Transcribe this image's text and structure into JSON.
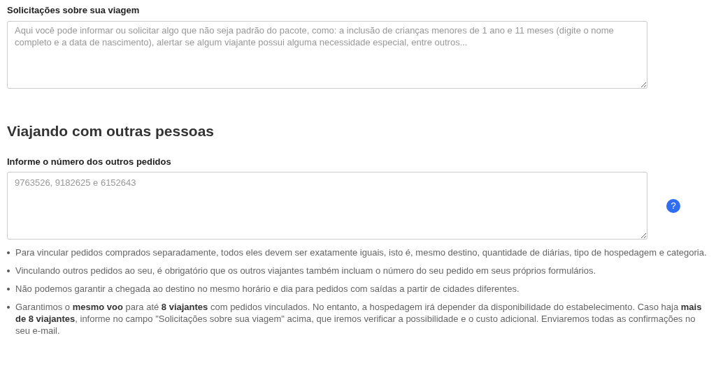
{
  "requests": {
    "label": "Solicitações sobre sua viagem",
    "placeholder": "Aqui você pode informar ou solicitar algo que não seja padrão do pacote, como: a inclusão de crianças menores de 1 ano e 11 meses (digite o nome completo e a data de nascimento), alertar se algum viajante possui alguma necessidade especial, entre outros..."
  },
  "section": {
    "title": "Viajando com outras pessoas"
  },
  "orders": {
    "label": "Informe o número dos outros pedidos",
    "placeholder": "9763526, 9182625 e 6152643",
    "help": "?"
  },
  "notes": [
    "Para vincular pedidos comprados separadamente, todos eles devem ser exatamente iguais, isto é, mesmo destino, quantidade de diárias, tipo de hospedagem e categoria.",
    "Vinculando outros pedidos ao seu, é obrigatório que os outros viajantes também incluam o número do seu pedido em seus próprios formulários.",
    "Não podemos garantir a chegada ao destino no mesmo horário e dia para pedidos com saídas a partir de cidades diferentes.",
    "Garantimos o **mesmo voo** para até **8 viajantes** com pedidos vinculados. No entanto, a hospedagem irá depender da disponibilidade do estabelecimento. Caso haja **mais de 8 viajantes**, informe no campo \"Solicitações sobre sua viagem\" acima, que iremos verificar a possibilidade e o custo adicional. Enviaremos todas as confirmações no seu e-mail."
  ]
}
